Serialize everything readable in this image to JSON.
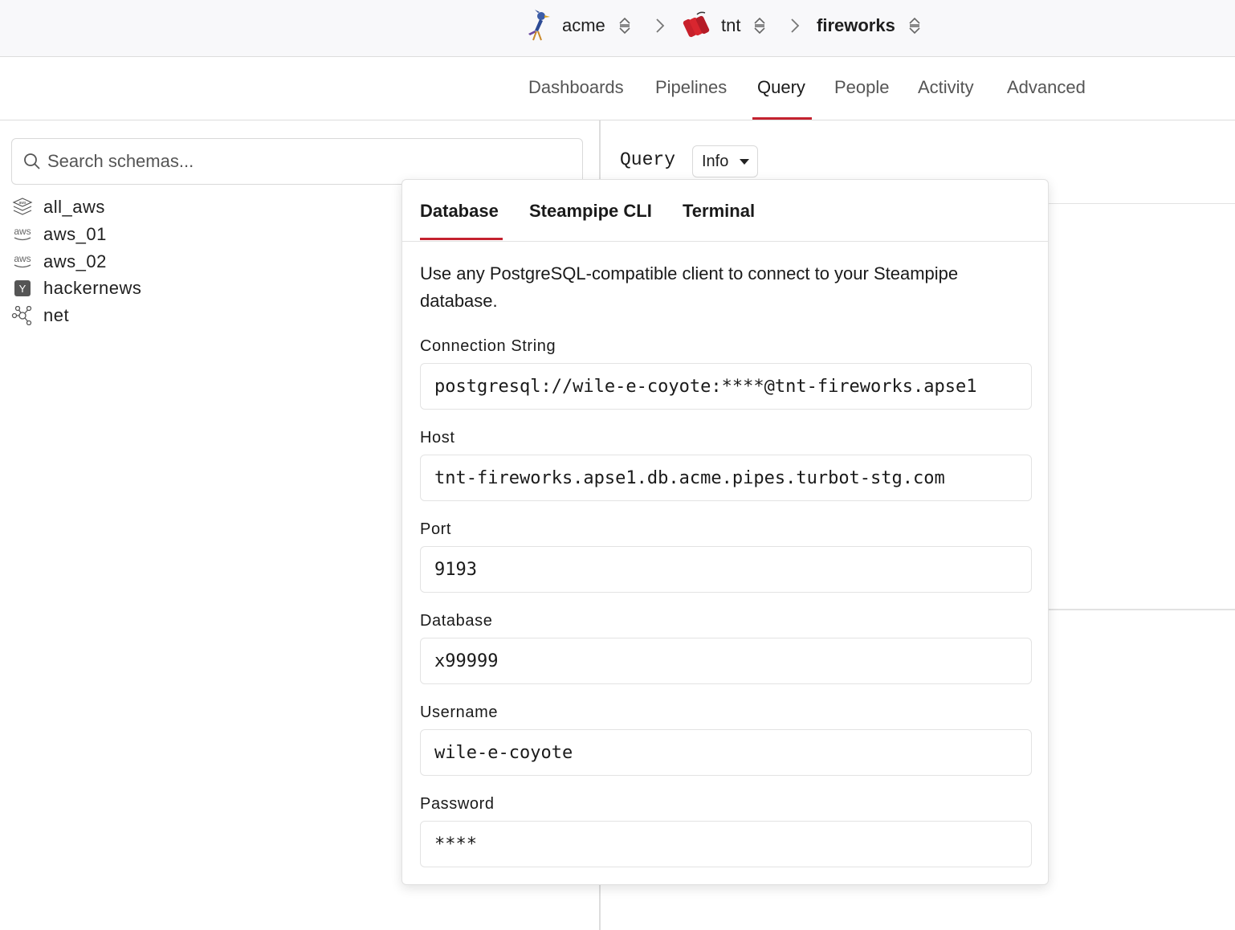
{
  "breadcrumb": {
    "org": "acme",
    "workspace": "tnt",
    "project": "fireworks"
  },
  "nav": {
    "tabs": [
      "Dashboards",
      "Pipelines",
      "Query",
      "People",
      "Activity",
      "Advanced"
    ],
    "active": "Query"
  },
  "sidebar": {
    "search_placeholder": "Search schemas...",
    "schemas": [
      {
        "name": "all_aws",
        "icon": "aws-aggregate-icon"
      },
      {
        "name": "aws_01",
        "icon": "aws-icon"
      },
      {
        "name": "aws_02",
        "icon": "aws-icon"
      },
      {
        "name": "hackernews",
        "icon": "hackernews-icon"
      },
      {
        "name": "net",
        "icon": "network-icon"
      }
    ]
  },
  "query_panel": {
    "title": "Query",
    "info_button": "Info"
  },
  "popup": {
    "tabs": [
      "Database",
      "Steampipe CLI",
      "Terminal"
    ],
    "active_tab": "Database",
    "description": "Use any PostgreSQL-compatible client to connect to your Steampipe database.",
    "fields": {
      "connection_string": {
        "label": "Connection String",
        "value": "postgresql://wile-e-coyote:****@tnt-fireworks.apse1"
      },
      "host": {
        "label": "Host",
        "value": "tnt-fireworks.apse1.db.acme.pipes.turbot-stg.com"
      },
      "port": {
        "label": "Port",
        "value": "9193"
      },
      "database": {
        "label": "Database",
        "value": "x99999"
      },
      "username": {
        "label": "Username",
        "value": "wile-e-coyote"
      },
      "password": {
        "label": "Password",
        "value": "****"
      }
    }
  },
  "colors": {
    "accent": "#c4222f",
    "border": "#dddddd",
    "topbar_bg": "#f8f8fa"
  }
}
